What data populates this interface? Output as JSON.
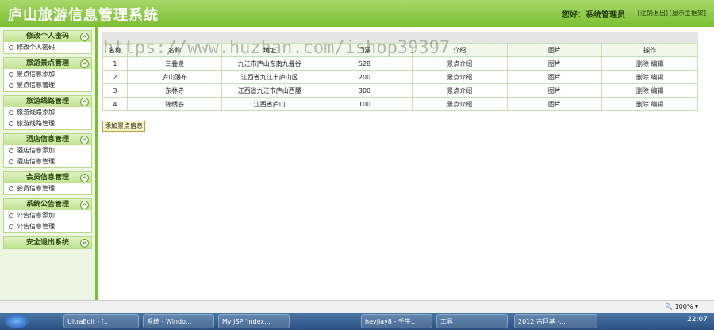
{
  "header": {
    "title": "庐山旅游信息管理系统",
    "greeting": "您好：系统管理员",
    "logout_link": "[注销退出]",
    "home_link": "[显示主框架]"
  },
  "sidebar": {
    "groups": [
      {
        "title": "修改个人密码",
        "items": [
          "修改个人密码"
        ]
      },
      {
        "title": "旅游景点管理",
        "items": [
          "景点信息添加",
          "景点信息管理"
        ]
      },
      {
        "title": "旅游线路管理",
        "items": [
          "旅游线路添加",
          "旅游线路管理"
        ]
      },
      {
        "title": "酒店信息管理",
        "items": [
          "酒店信息添加",
          "酒店信息管理"
        ]
      },
      {
        "title": "会员信息管理",
        "items": [
          "会员信息管理"
        ]
      },
      {
        "title": "系统公告管理",
        "items": [
          "公告信息添加",
          "公告信息管理"
        ]
      },
      {
        "title": "安全退出系统",
        "items": []
      }
    ]
  },
  "table": {
    "columns": [
      "名称",
      "名称",
      "地址",
      "门票",
      "介绍",
      "图片",
      "操作"
    ],
    "rows": [
      {
        "no": "1",
        "name": "三叠泉",
        "address": "九江市庐山东南九叠谷",
        "price": "528",
        "intro": "景点介绍",
        "image": "图片",
        "delete": "删除",
        "edit": "编辑"
      },
      {
        "no": "2",
        "name": "庐山瀑布",
        "address": "江西省九江市庐山区",
        "price": "200",
        "intro": "景点介绍",
        "image": "图片",
        "delete": "删除",
        "edit": "编辑"
      },
      {
        "no": "3",
        "name": "东林寺",
        "address": "江西省九江市庐山西麓",
        "price": "300",
        "intro": "景点介绍",
        "image": "图片",
        "delete": "删除",
        "edit": "编辑"
      },
      {
        "no": "4",
        "name": "锦绣谷",
        "address": "江西省庐山",
        "price": "100",
        "intro": "景点介绍",
        "image": "图片",
        "delete": "删除",
        "edit": "编辑"
      }
    ],
    "add_button": "添加景点信息"
  },
  "watermark": "https://www.huzhan.com/ishop39397",
  "statusbar": {
    "zoom": "100%"
  },
  "taskbar": {
    "buttons": [
      "UltraEdit - [...",
      "系统 - Windo...",
      "My JSP 'index...",
      "heyjiay8 - 千牛...",
      "工具",
      "2012 古巨基 -..."
    ],
    "clock": "22:07"
  }
}
